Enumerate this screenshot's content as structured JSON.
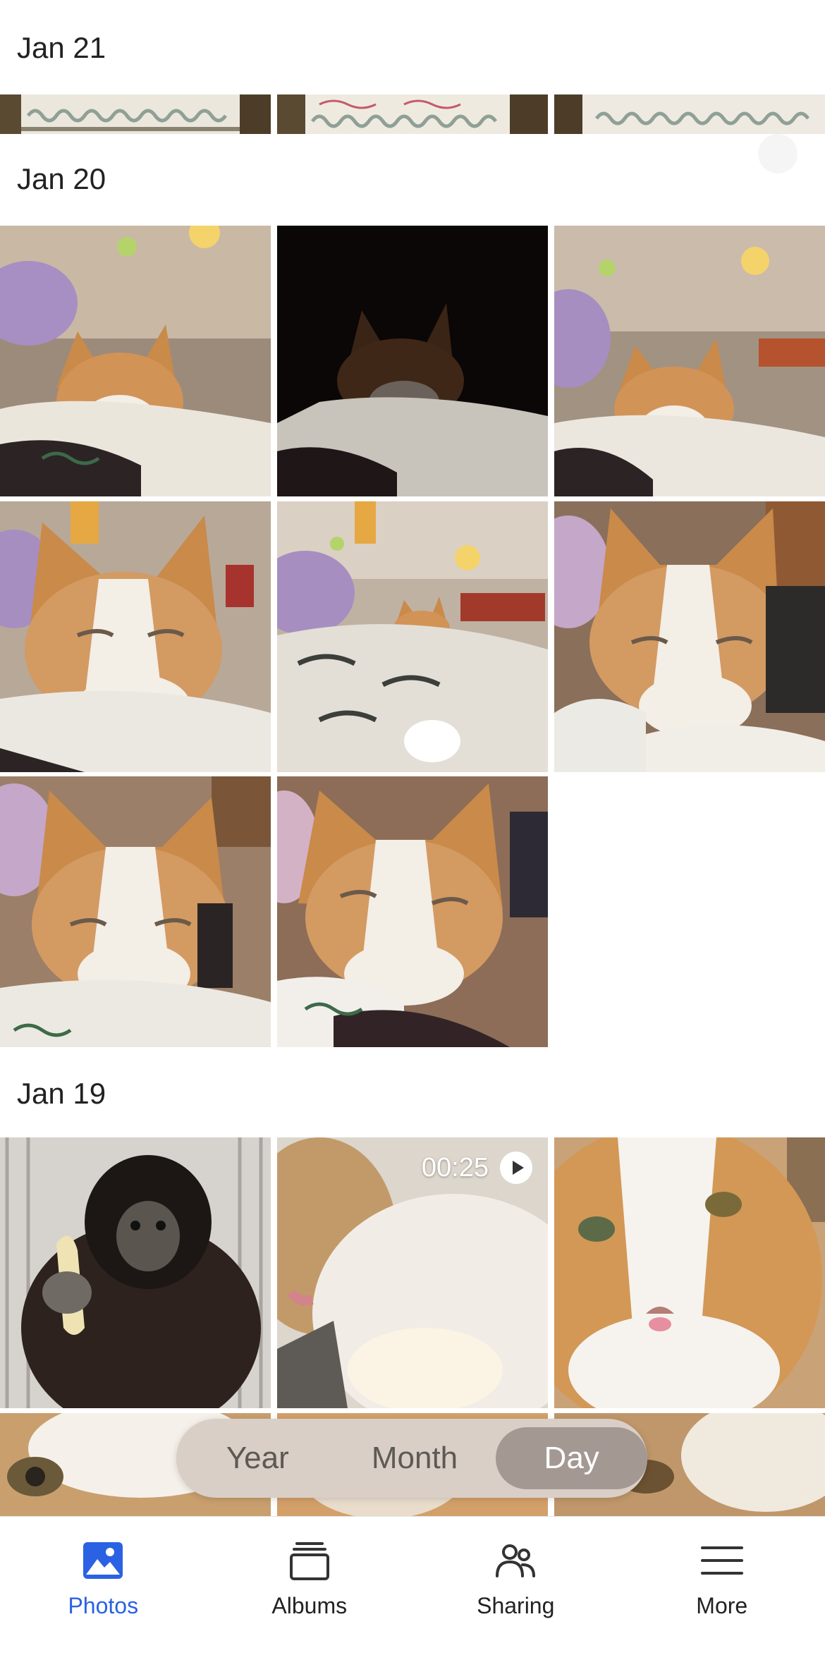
{
  "sections": [
    {
      "date": "Jan 21"
    },
    {
      "date": "Jan 20"
    },
    {
      "date": "Jan 19"
    }
  ],
  "video": {
    "duration": "00:25",
    "icon": "play-icon"
  },
  "view_switcher": {
    "options": [
      "Year",
      "Month",
      "Day"
    ],
    "selected": "Day"
  },
  "tabbar": {
    "items": [
      {
        "label": "Photos",
        "icon": "photos-icon",
        "active": true
      },
      {
        "label": "Albums",
        "icon": "albums-icon",
        "active": false
      },
      {
        "label": "Sharing",
        "icon": "sharing-icon",
        "active": false
      },
      {
        "label": "More",
        "icon": "menu-icon",
        "active": false
      }
    ]
  },
  "colors": {
    "accent": "#2b62e3",
    "switcher_bg": "#d9cfc7",
    "switcher_active": "#a39992"
  }
}
